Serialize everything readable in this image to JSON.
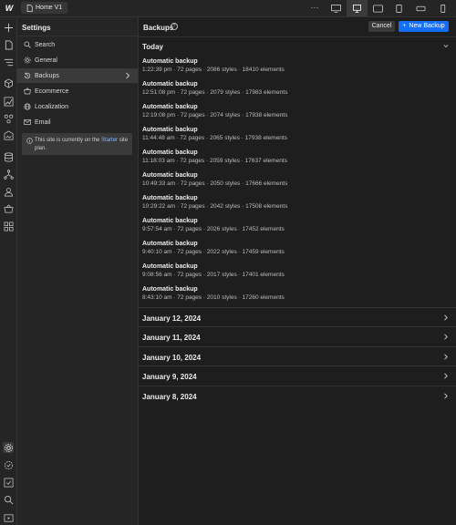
{
  "topbar": {
    "logo": "W",
    "page_name": "Home V1",
    "more_label": "···"
  },
  "settings": {
    "title": "Settings",
    "nav": [
      {
        "label": "Search",
        "icon": "search-icon"
      },
      {
        "label": "General",
        "icon": "gear-icon"
      },
      {
        "label": "Backups",
        "icon": "history-icon"
      },
      {
        "label": "Ecommerce",
        "icon": "cart-icon"
      },
      {
        "label": "Localization",
        "icon": "globe-icon"
      },
      {
        "label": "Email",
        "icon": "mail-icon"
      }
    ],
    "active_nav": "Backups",
    "notice_prefix": "This site is currently on the ",
    "notice_link": "Starter",
    "notice_suffix": " site plan."
  },
  "main": {
    "title": "Backups",
    "help": "?",
    "cancel_label": "Cancel",
    "new_label": "New Backup",
    "new_icon": "+",
    "today_label": "Today",
    "backups": [
      {
        "title": "Automatic backup",
        "meta": "1:22:39 pm · 72 pages · 2086 styles · 18410 elements"
      },
      {
        "title": "Automatic backup",
        "meta": "12:51:08 pm · 72 pages · 2079 styles · 17983 elements"
      },
      {
        "title": "Automatic backup",
        "meta": "12:19:08 pm · 72 pages · 2074 styles · 17938 elements"
      },
      {
        "title": "Automatic backup",
        "meta": "11:44:48 am · 72 pages · 2065 styles · 17938 elements"
      },
      {
        "title": "Automatic backup",
        "meta": "11:18:03 am · 72 pages · 2059 styles · 17637 elements"
      },
      {
        "title": "Automatic backup",
        "meta": "10:49:33 am · 72 pages · 2050 styles · 17666 elements"
      },
      {
        "title": "Automatic backup",
        "meta": "10:29:22 am · 72 pages · 2042 styles · 17508 elements"
      },
      {
        "title": "Automatic backup",
        "meta": "9:57:54 am · 72 pages · 2026 styles · 17452 elements"
      },
      {
        "title": "Automatic backup",
        "meta": "9:40:10 am · 72 pages · 2022 styles · 17459 elements"
      },
      {
        "title": "Automatic backup",
        "meta": "9:08:56 am · 72 pages · 2017 styles · 17401 elements"
      },
      {
        "title": "Automatic backup",
        "meta": "8:43:10 am · 72 pages · 2010 styles · 17260 elements"
      }
    ],
    "dates": [
      "January 12, 2024",
      "January 11, 2024",
      "January 10, 2024",
      "January 9, 2024",
      "January 8, 2024"
    ]
  },
  "colors": {
    "accent": "#146ef5",
    "link": "#8ab4ff",
    "background": "#1e1e1e",
    "panel": "#252525"
  }
}
